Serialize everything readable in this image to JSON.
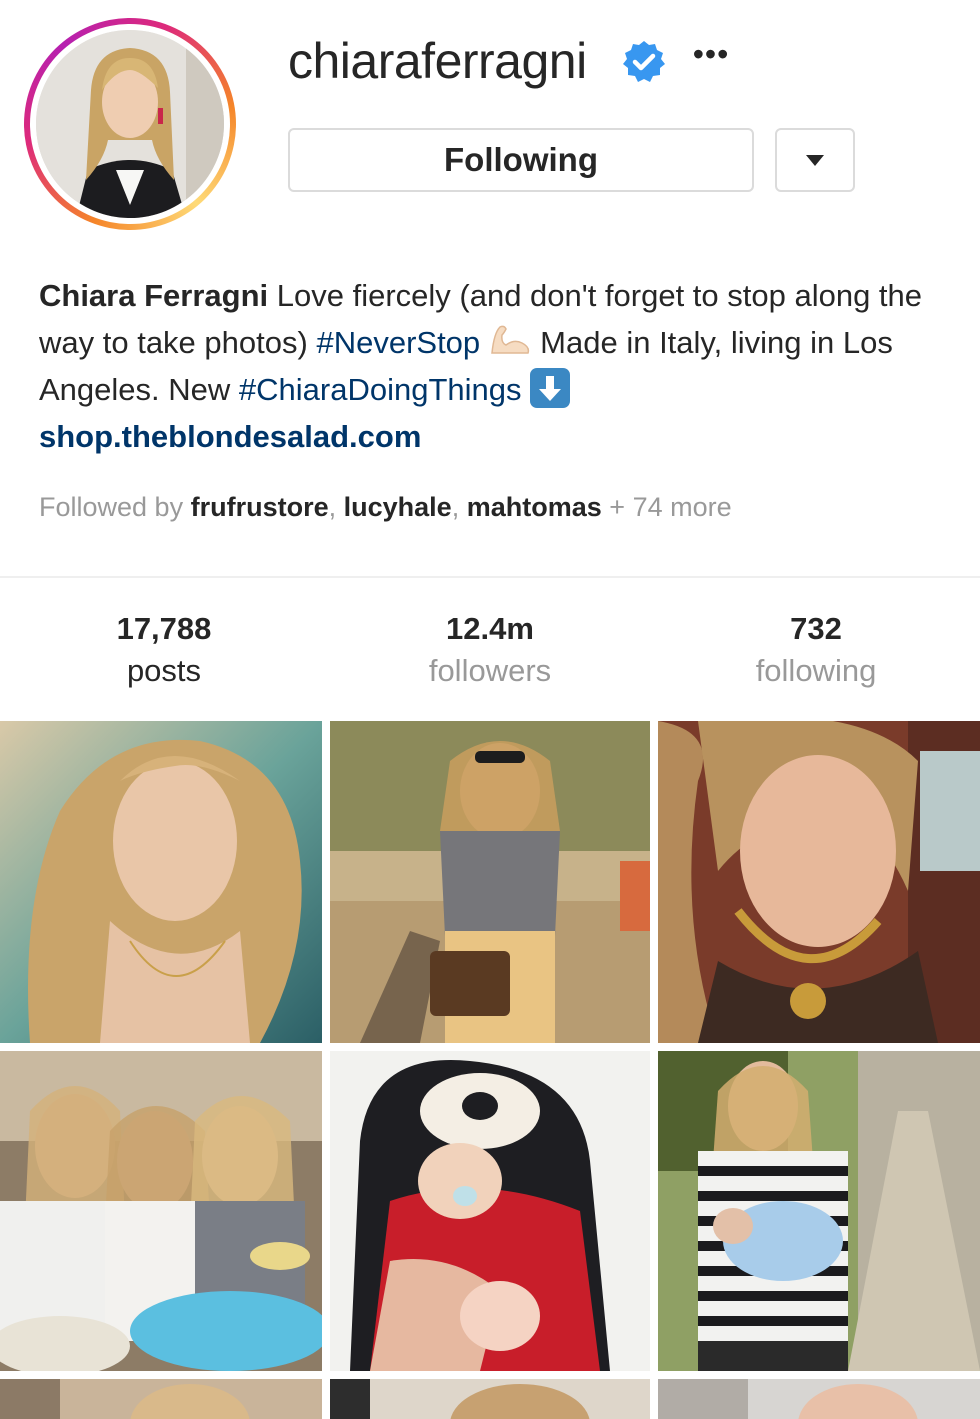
{
  "profile": {
    "username": "chiaraferragni",
    "follow_label": "Following",
    "bio": {
      "name": "Chiara Ferragni",
      "text1": "Love fiercely (and don't forget to stop along the way to take photos)",
      "tag1": "#NeverStop",
      "text2": "Made in Italy, living in Los Angeles. New",
      "tag2": "#ChiaraDoingThings",
      "link": "shop.theblondesalad.com"
    },
    "followed_by": {
      "prefix": "Followed by",
      "users": [
        "frufrustore",
        "lucyhale",
        "mahtomas"
      ],
      "suffix": "+ 74 more"
    }
  },
  "stats": {
    "posts": {
      "value": "17,788",
      "label": "posts"
    },
    "followers": {
      "value": "12.4m",
      "label": "followers"
    },
    "following": {
      "value": "732",
      "label": "following"
    }
  },
  "colors": {
    "link": "#003569",
    "muted": "#999999",
    "verified": "#3897f0",
    "border": "#dbdbdb"
  },
  "icons": [
    "verified-badge-icon",
    "more-options-icon",
    "chevron-down-icon",
    "flexed-biceps-emoji",
    "down-arrow-emoji"
  ]
}
